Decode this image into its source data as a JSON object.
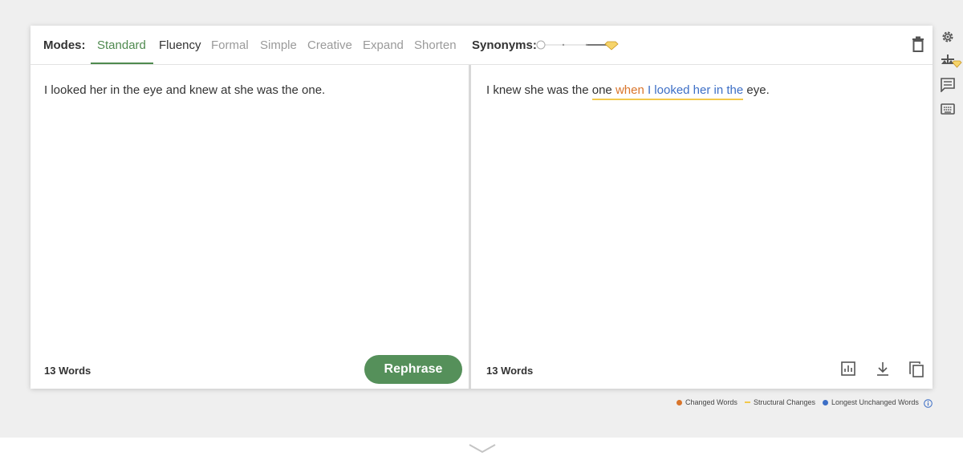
{
  "toolbar": {
    "modes_label": "Modes:",
    "modes": [
      "Standard",
      "Fluency",
      "Formal",
      "Simple",
      "Creative",
      "Expand",
      "Shorten"
    ],
    "active_mode": "Standard",
    "synonyms_label": "Synonyms:",
    "synonyms_level": 0.3
  },
  "input": {
    "text": "I looked her in the eye and knew at she was the one.",
    "word_count": "13 Words",
    "rephrase_label": "Rephrase"
  },
  "output": {
    "segments": {
      "plain1": "I knew she was the ",
      "struct1": "one ",
      "changed1": "when",
      "longest1": " I looked her in the",
      "plain2": " eye."
    },
    "word_count": "13 Words"
  },
  "legend": {
    "changed": "Changed Words",
    "structural": "Structural Changes",
    "longest": "Longest Unchanged Words"
  },
  "colors": {
    "accent_green": "#4f8a4f",
    "button_green": "#55905a",
    "changed_orange": "#d9752b",
    "structural_yellow": "#f2c94c",
    "longest_blue": "#3d6fc6"
  },
  "icons": [
    "trash-icon",
    "settings-gear-icon",
    "compare-premium-icon",
    "comments-icon",
    "keyboard-icon",
    "statistics-icon",
    "download-icon",
    "copy-icon",
    "info-icon",
    "chevron-down-icon",
    "premium-diamond-icon"
  ]
}
